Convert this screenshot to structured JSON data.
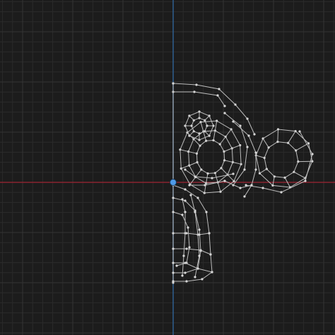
{
  "viewport": {
    "view": "front-orthographic",
    "shading": "wireframe",
    "background_color": "#1c1c1c",
    "grid_minor_color": "#2b2b2b",
    "grid_major_color": "#343434",
    "x_axis_color": "#8a2430",
    "z_axis_color": "#2f5f8f",
    "origin_color": "#4f9be8",
    "wire_color": "#bdbdbd",
    "vertex_color": "#d8d8d8"
  },
  "object": {
    "name_icon": "monkey-mesh-icon",
    "mirror_half": "right"
  }
}
